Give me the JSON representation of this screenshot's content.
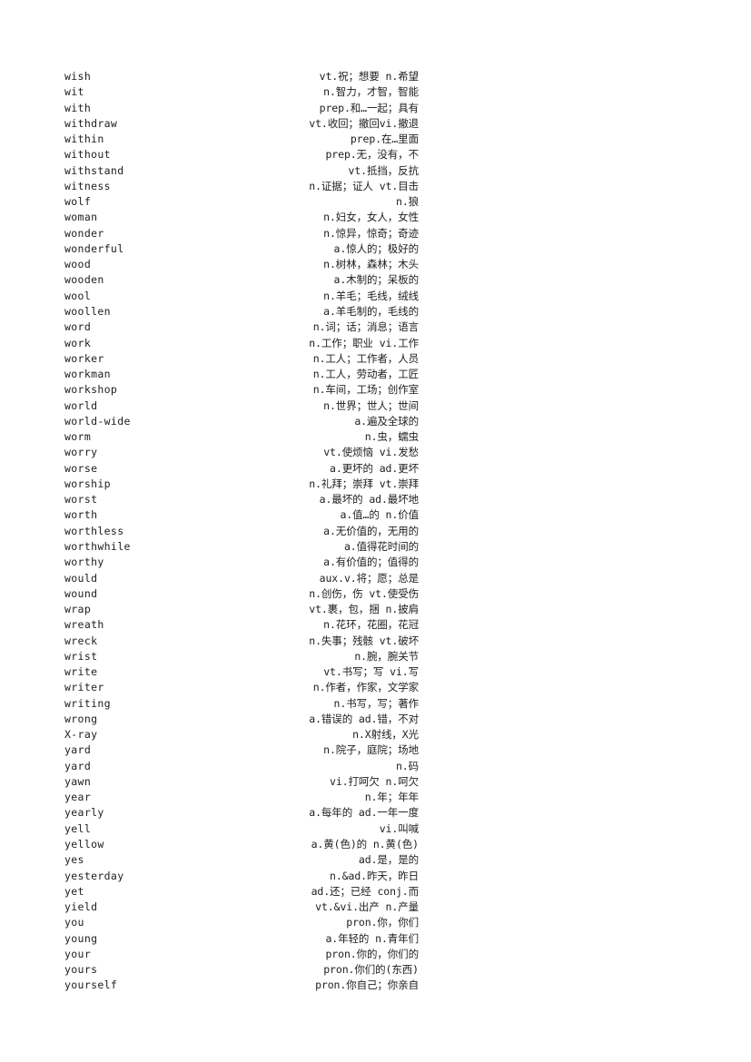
{
  "page": {
    "background_color": "#ffffff",
    "text_color": "#1d1d1d",
    "document_type": "english-chinese-vocabulary-list",
    "column_headers_visible": false
  },
  "entries": [
    {
      "word": "wish",
      "definition": "vt.祝；想要 n.希望"
    },
    {
      "word": "wit",
      "definition": "n.智力，才智，智能"
    },
    {
      "word": "with",
      "definition": "prep.和…一起；具有"
    },
    {
      "word": "withdraw",
      "definition": "vt.收回；撤回vi.撤退"
    },
    {
      "word": "within",
      "definition": "prep.在…里面"
    },
    {
      "word": "without",
      "definition": "prep.无，没有，不"
    },
    {
      "word": "withstand",
      "definition": "vt.抵挡，反抗"
    },
    {
      "word": "witness",
      "definition": "n.证据；证人 vt.目击"
    },
    {
      "word": "wolf",
      "definition": "n.狼"
    },
    {
      "word": "woman",
      "definition": "n.妇女，女人，女性"
    },
    {
      "word": "wonder",
      "definition": "n.惊异，惊奇；奇迹"
    },
    {
      "word": "wonderful",
      "definition": "a.惊人的；极好的"
    },
    {
      "word": "wood",
      "definition": "n.树林，森林；木头"
    },
    {
      "word": "wooden",
      "definition": "a.木制的；呆板的"
    },
    {
      "word": "wool",
      "definition": "n.羊毛；毛线，绒线"
    },
    {
      "word": "woollen",
      "definition": "a.羊毛制的，毛线的"
    },
    {
      "word": "word",
      "definition": "n.词；话；消息；语言"
    },
    {
      "word": "work",
      "definition": "n.工作；职业 vi.工作"
    },
    {
      "word": "worker",
      "definition": "n.工人；工作者，人员"
    },
    {
      "word": "workman",
      "definition": "n.工人，劳动者，工匠"
    },
    {
      "word": "workshop",
      "definition": "n.车间，工场；创作室"
    },
    {
      "word": "world",
      "definition": "n.世界；世人；世间"
    },
    {
      "word": "world-wide",
      "definition": "a.遍及全球的"
    },
    {
      "word": "worm",
      "definition": "n.虫，蠕虫"
    },
    {
      "word": "worry",
      "definition": "vt.使烦恼 vi.发愁"
    },
    {
      "word": "worse",
      "definition": "a.更坏的 ad.更坏"
    },
    {
      "word": "worship",
      "definition": "n.礼拜；崇拜 vt.崇拜"
    },
    {
      "word": "worst",
      "definition": "a.最坏的 ad.最坏地"
    },
    {
      "word": "worth",
      "definition": "a.值…的 n.价值"
    },
    {
      "word": "worthless",
      "definition": "a.无价值的，无用的"
    },
    {
      "word": "worthwhile",
      "definition": "a.值得花时间的"
    },
    {
      "word": "worthy",
      "definition": "a.有价值的；值得的"
    },
    {
      "word": "would",
      "definition": "aux.v.将；愿；总是"
    },
    {
      "word": "wound",
      "definition": "n.创伤，伤 vt.使受伤"
    },
    {
      "word": "wrap",
      "definition": "vt.裹，包，捆 n.披肩"
    },
    {
      "word": "wreath",
      "definition": "n.花环，花圈，花冠"
    },
    {
      "word": "wreck",
      "definition": "n.失事；残骸 vt.破坏"
    },
    {
      "word": "wrist",
      "definition": "n.腕，腕关节"
    },
    {
      "word": "write",
      "definition": "vt.书写；写 vi.写"
    },
    {
      "word": "writer",
      "definition": "n.作者，作家，文学家"
    },
    {
      "word": "writing",
      "definition": "n.书写，写；著作"
    },
    {
      "word": "wrong",
      "definition": "a.错误的 ad.错，不对"
    },
    {
      "word": "X-ray",
      "definition": "n.X射线，X光"
    },
    {
      "word": "yard",
      "definition": "n.院子，庭院；场地"
    },
    {
      "word": "yard",
      "definition": "n.码"
    },
    {
      "word": "yawn",
      "definition": "vi.打呵欠 n.呵欠"
    },
    {
      "word": "year",
      "definition": "n.年；年年"
    },
    {
      "word": "yearly",
      "definition": "a.每年的 ad.一年一度"
    },
    {
      "word": "yell",
      "definition": "vi.叫喊"
    },
    {
      "word": "yellow",
      "definition": "a.黄(色)的 n.黄(色)"
    },
    {
      "word": "yes",
      "definition": "ad.是，是的"
    },
    {
      "word": "yesterday",
      "definition": "n.&ad.昨天，昨日"
    },
    {
      "word": "yet",
      "definition": "ad.还；已经 conj.而"
    },
    {
      "word": "yield",
      "definition": "vt.&vi.出产 n.产量"
    },
    {
      "word": "you",
      "definition": "pron.你，你们"
    },
    {
      "word": "young",
      "definition": "a.年轻的 n.青年们"
    },
    {
      "word": "your",
      "definition": "pron.你的，你们的"
    },
    {
      "word": "yours",
      "definition": "pron.你们的(东西)"
    },
    {
      "word": "yourself",
      "definition": "pron.你自己；你亲自"
    }
  ]
}
